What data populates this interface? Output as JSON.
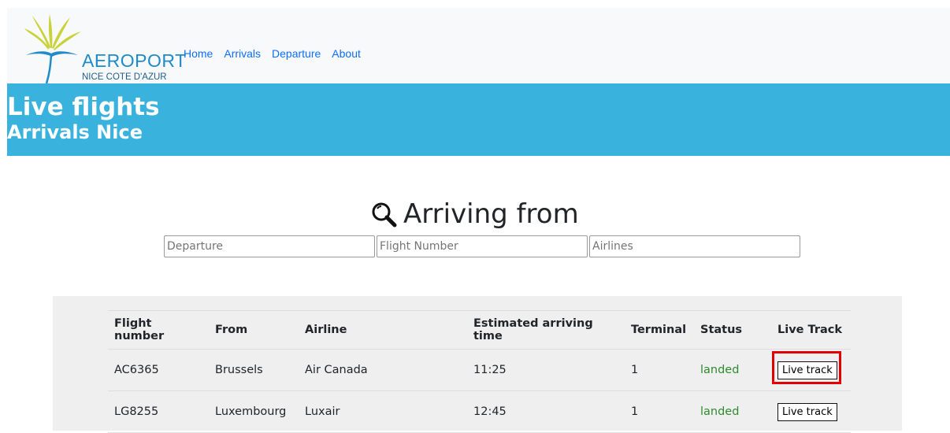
{
  "nav": {
    "logo_text": "AEROPORT",
    "logo_sub": "NICE COTE D'AZUR",
    "links": [
      "Home",
      "Arrivals",
      "Departure",
      "About"
    ]
  },
  "banner": {
    "title": "Live flights",
    "subtitle": "Arrivals Nice"
  },
  "search": {
    "heading": "Arriving from",
    "inputs": [
      {
        "placeholder": "Departure"
      },
      {
        "placeholder": "Flight Number"
      },
      {
        "placeholder": "Airlines"
      }
    ]
  },
  "table": {
    "headers": [
      "Flight number",
      "From",
      "Airline",
      "Estimated arriving time",
      "Terminal",
      "Status",
      "Live Track"
    ],
    "rows": [
      {
        "flight": "AC6365",
        "from": "Brussels",
        "airline": "Air Canada",
        "eta": "11:25",
        "terminal": "1",
        "status": "landed",
        "track": "Live track"
      },
      {
        "flight": "LG8255",
        "from": "Luxembourg",
        "airline": "Luxair",
        "eta": "12:45",
        "terminal": "1",
        "status": "landed",
        "track": "Live track"
      }
    ]
  },
  "colors": {
    "banner": "#3ab2de",
    "link": "#0d6efd",
    "status_landed": "#2e8b2e",
    "highlight": "#e30000"
  }
}
